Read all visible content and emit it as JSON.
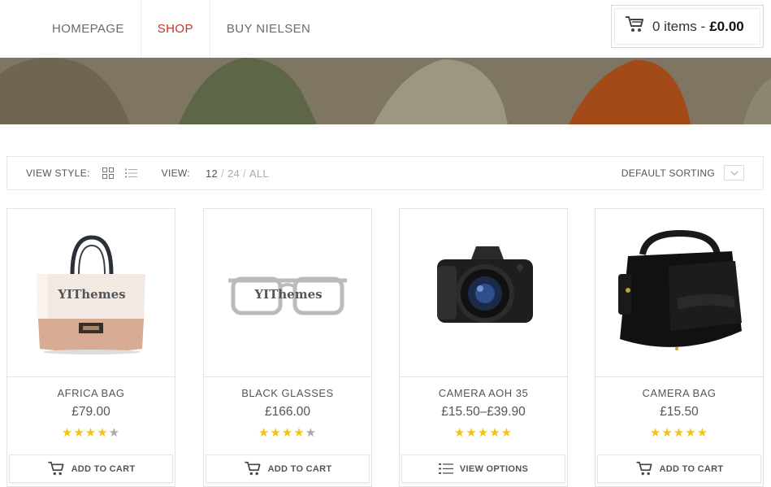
{
  "nav": {
    "items": [
      {
        "label": "HOMEPAGE",
        "active": false
      },
      {
        "label": "SHOP",
        "active": true
      },
      {
        "label": "BUY NIELSEN",
        "active": false
      }
    ]
  },
  "cart": {
    "items_text": "0 items -",
    "total": "£0.00",
    "icon": "cart-icon"
  },
  "toolbar": {
    "view_style_label": "VIEW STYLE:",
    "view_label": "VIEW:",
    "per_page": [
      "12",
      "24",
      "ALL"
    ],
    "per_page_selected": "12",
    "sorting_label": "DEFAULT SORTING"
  },
  "products": [
    {
      "name": "AFRICA BAG",
      "price": "£79.00",
      "rating": 4,
      "action": "ADD TO CART",
      "watermark": "YIThemes",
      "action_icon": "cart-icon"
    },
    {
      "name": "BLACK GLASSES",
      "price": "£166.00",
      "rating": 4,
      "action": "ADD TO CART",
      "watermark": "YIThemes",
      "action_icon": "cart-icon"
    },
    {
      "name": "CAMERA AOH 35",
      "price": "£15.50–£39.90",
      "rating": 5,
      "action": "VIEW OPTIONS",
      "watermark": "",
      "action_icon": "list-icon"
    },
    {
      "name": "CAMERA BAG",
      "price": "£15.50",
      "rating": 5,
      "action": "ADD TO CART",
      "watermark": "",
      "action_icon": "cart-icon"
    }
  ],
  "colors": {
    "accent": "#c9302c",
    "star": "#f2c21a",
    "star_empty": "#aaaaaa",
    "banner": "#7d7563"
  }
}
